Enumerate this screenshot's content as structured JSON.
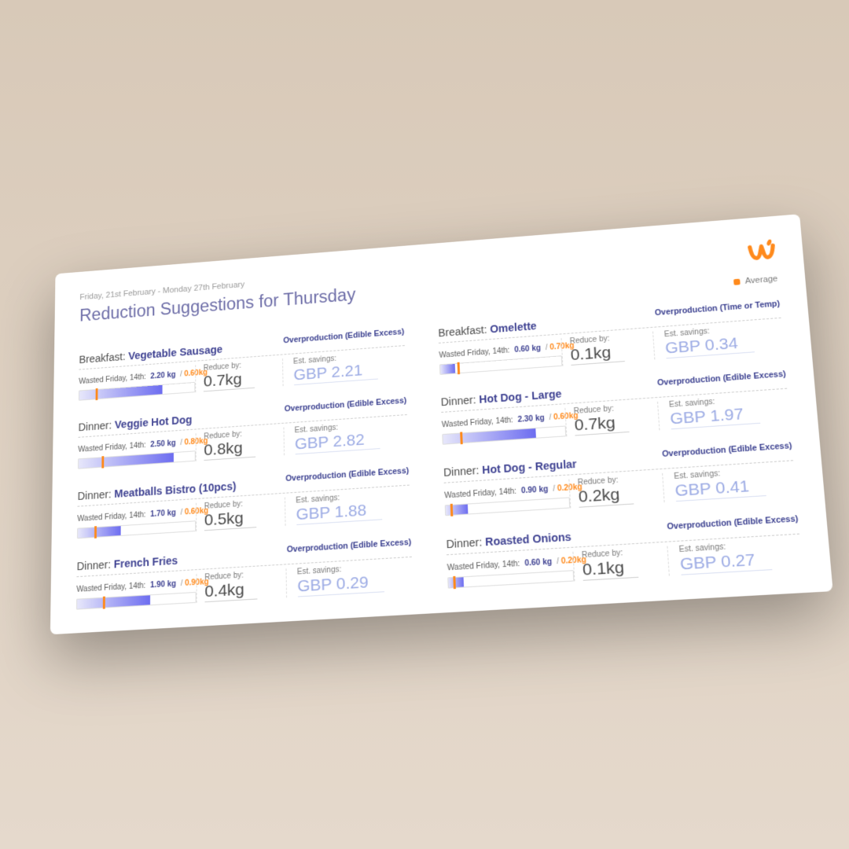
{
  "dateRange": "Friday, 21st February - Monday 27th February",
  "title": "Reduction Suggestions for Thursday",
  "legend": "Average",
  "labels": {
    "wastedPrefix": "Wasted Friday, 14th:",
    "reduceBy": "Reduce by:",
    "estSavings": "Est. savings:"
  },
  "cards": [
    {
      "meal": "Breakfast",
      "dish": "Vegetable Sausage",
      "type": "Overproduction (Edible Excess)",
      "wastedA": "2.20 kg",
      "wastedB": "0.60kg",
      "barPct": 72,
      "tickPct": 14,
      "reduce": "0.7kg",
      "savings": "GBP 2.21",
      "pos": "L"
    },
    {
      "meal": "Breakfast",
      "dish": "Omelette",
      "type": "Overproduction (Time or Temp)",
      "wastedA": "0.60 kg",
      "wastedB": "0.70kg",
      "barPct": 12,
      "tickPct": 14,
      "reduce": "0.1kg",
      "savings": "GBP 0.34",
      "pos": "R"
    },
    {
      "meal": "Dinner",
      "dish": "Veggie Hot Dog",
      "type": "Overproduction (Edible Excess)",
      "wastedA": "2.50 kg",
      "wastedB": "0.80kg",
      "barPct": 82,
      "tickPct": 20,
      "reduce": "0.8kg",
      "savings": "GBP 2.82",
      "pos": "L"
    },
    {
      "meal": "Dinner",
      "dish": "Hot Dog - Large",
      "type": "Overproduction (Edible Excess)",
      "wastedA": "2.30 kg",
      "wastedB": "0.60kg",
      "barPct": 76,
      "tickPct": 14,
      "reduce": "0.7kg",
      "savings": "GBP 1.97",
      "pos": "R"
    },
    {
      "meal": "Dinner",
      "dish": "Meatballs Bistro (10pcs)",
      "type": "Overproduction (Edible Excess)",
      "wastedA": "1.70 kg",
      "wastedB": "0.60kg",
      "barPct": 37,
      "tickPct": 14,
      "reduce": "0.5kg",
      "savings": "GBP 1.88",
      "pos": "L"
    },
    {
      "meal": "Dinner",
      "dish": "Hot Dog - Regular",
      "type": "Overproduction (Edible Excess)",
      "wastedA": "0.90 kg",
      "wastedB": "0.20kg",
      "barPct": 18,
      "tickPct": 4,
      "reduce": "0.2kg",
      "savings": "GBP 0.41",
      "pos": "R"
    },
    {
      "meal": "Dinner",
      "dish": "French Fries",
      "type": "Overproduction (Edible Excess)",
      "wastedA": "1.90 kg",
      "wastedB": "0.90kg",
      "barPct": 62,
      "tickPct": 22,
      "reduce": "0.4kg",
      "savings": "GBP 0.29",
      "pos": "L"
    },
    {
      "meal": "Dinner",
      "dish": "Roasted Onions",
      "type": "Overproduction (Edible Excess)",
      "wastedA": "0.60 kg",
      "wastedB": "0.20kg",
      "barPct": 12,
      "tickPct": 4,
      "reduce": "0.1kg",
      "savings": "GBP 0.27",
      "pos": "R"
    }
  ],
  "colors": {
    "accent": "#ff8a1c",
    "primary": "#6d6df0",
    "heading": "#6e6ea8"
  }
}
